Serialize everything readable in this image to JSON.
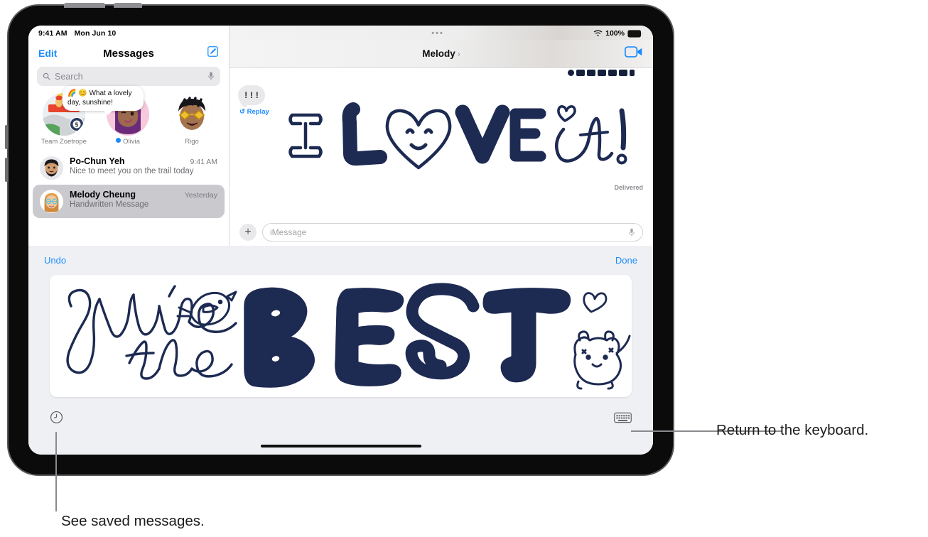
{
  "statusbar": {
    "time": "9:41 AM",
    "date": "Mon Jun 10",
    "battery": "100%"
  },
  "sidebar": {
    "edit_label": "Edit",
    "title": "Messages",
    "compose_icon": "compose-icon",
    "search": {
      "placeholder": "Search",
      "icon": "search-icon",
      "mic_icon": "microphone-icon"
    },
    "pinned": [
      {
        "name": "Team Zoetrope",
        "badge": "5",
        "has_dot": false
      },
      {
        "name": "Olivia",
        "has_dot": true,
        "tip": "What a lovely day, sunshine!",
        "tip_emoji": "🌈 😊"
      },
      {
        "name": "Rigo",
        "has_dot": false
      }
    ],
    "conversations": [
      {
        "name": "Po-Chun Yeh",
        "time": "9:41 AM",
        "preview": "Nice to meet you on the trail today",
        "selected": false
      },
      {
        "name": "Melody Cheung",
        "time": "Yesterday",
        "preview": "Handwritten Message",
        "selected": true
      }
    ]
  },
  "chat": {
    "title": "Melody",
    "chevron": "›",
    "facetime_icon": "video-camera-icon",
    "mini_bubble_text": "!!!",
    "replay_label": "Replay",
    "replay_icon": "replay-arrow-icon",
    "drawing_text": "I L♥VE it!",
    "delivered_label": "Delivered",
    "composer": {
      "plus_icon": "plus-icon",
      "placeholder": "iMessage",
      "mic_icon": "microphone-icon"
    }
  },
  "handwriting": {
    "undo_label": "Undo",
    "done_label": "Done",
    "canvas_text": "You're the BEST",
    "saved_icon": "clock-icon",
    "keyboard_icon": "keyboard-icon"
  },
  "callouts": [
    {
      "text": "Return to the keyboard."
    },
    {
      "text": "See saved messages."
    }
  ],
  "colors": {
    "accent": "#1a8cff",
    "ink": "#1d2a52",
    "selected_row": "#c9c9ce"
  }
}
